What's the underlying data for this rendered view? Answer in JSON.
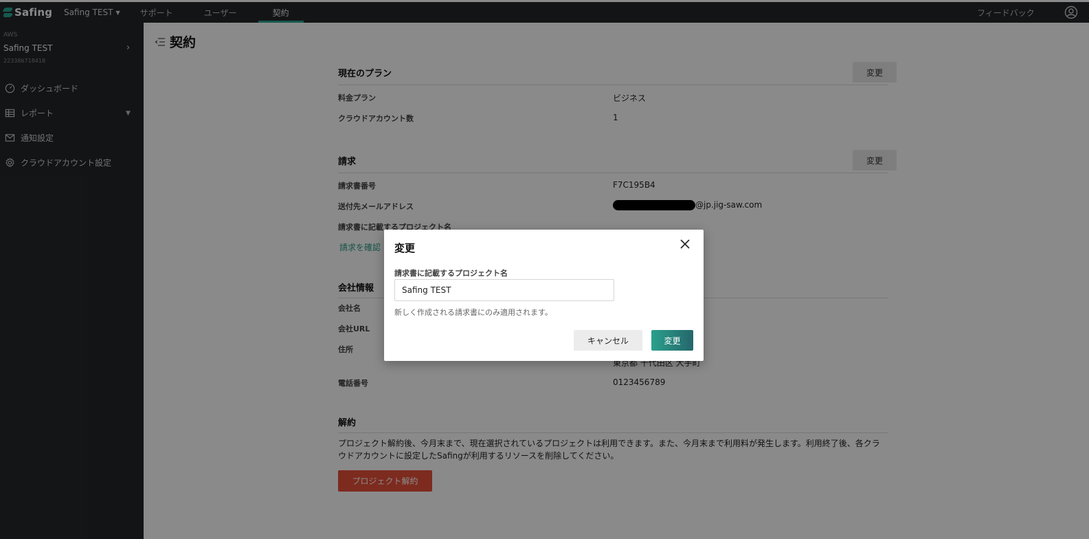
{
  "app": {
    "logo_text": "Safing"
  },
  "topbar": {
    "project_selector": "Safing TEST",
    "tabs": [
      {
        "label": "サポート"
      },
      {
        "label": "ユーザー"
      },
      {
        "label": "契約"
      }
    ],
    "feedback": "フィードバック"
  },
  "sidebar": {
    "account_cloud": "AWS",
    "account_name": "Safing TEST",
    "account_id": "223386718418",
    "items": [
      {
        "label": "ダッシュボード",
        "icon": "dashboard-icon"
      },
      {
        "label": "レポート",
        "icon": "grid-icon"
      },
      {
        "label": "通知設定",
        "icon": "mail-icon"
      },
      {
        "label": "クラウドアカウント設定",
        "icon": "gear-icon"
      }
    ]
  },
  "page": {
    "title": "契約"
  },
  "plan": {
    "heading": "現在のプラン",
    "change_label": "変更",
    "rows": [
      {
        "label": "料金プラン",
        "value": "ビジネス"
      },
      {
        "label": "クラウドアカウント数",
        "value": "1"
      }
    ]
  },
  "billing": {
    "heading": "請求",
    "change_label": "変更",
    "rows": [
      {
        "label": "請求書番号",
        "value": "F7C195B4"
      },
      {
        "label": "送付先メールアドレス",
        "value": "@jp.jig-saw.com"
      },
      {
        "label": "請求書に記載するプロジェクト名",
        "value": ""
      }
    ],
    "link": "請求を確認"
  },
  "company": {
    "heading": "会社情報",
    "rows": [
      {
        "label": "会社名",
        "value": ""
      },
      {
        "label": "会社URL",
        "value": ""
      },
      {
        "label": "住所",
        "value": "東京都 千代田区 大手町"
      },
      {
        "label": "電話番号",
        "value": "0123456789"
      }
    ]
  },
  "cancellation": {
    "heading": "解約",
    "description": "プロジェクト解約後、今月末まで、現在選択されているプロジェクトは利用できます。また、今月末まで利用料が発生します。利用終了後、各クラウドアカウントに設定したSafingが利用するリソースを削除してください。",
    "button": "プロジェクト解約"
  },
  "modal": {
    "title": "変更",
    "field_label": "請求書に記載するプロジェクト名",
    "field_value": "Safing TEST",
    "help": "新しく作成される請求書にのみ適用されます。",
    "cancel": "キャンセル",
    "submit": "変更"
  },
  "colors": {
    "topbar": "#232629",
    "accent": "#2aa58f",
    "danger": "#e8503a",
    "submit_gradient_end": "#25666b"
  }
}
